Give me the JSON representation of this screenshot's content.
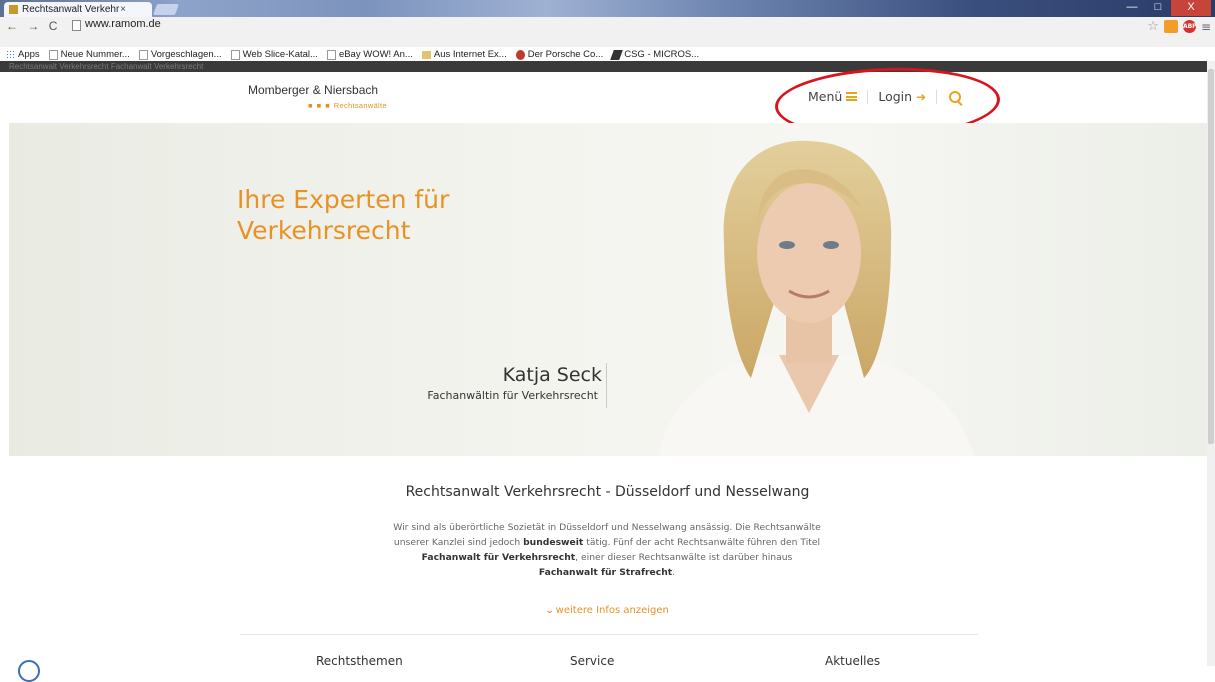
{
  "browser": {
    "tab_title": "Rechtsanwalt Verkehr",
    "tab_close": "×",
    "url": "www.ramom.de",
    "nav": {
      "back": "←",
      "forward": "→",
      "reload": "C"
    },
    "bookmarks": [
      {
        "label": "Apps",
        "icon": "apps"
      },
      {
        "label": "Neue Nummer...",
        "icon": "page"
      },
      {
        "label": "Vorgeschlagen...",
        "icon": "page"
      },
      {
        "label": "Web Slice-Katal...",
        "icon": "page"
      },
      {
        "label": "eBay WOW! An...",
        "icon": "page"
      },
      {
        "label": "Aus Internet Ex...",
        "icon": "folder"
      },
      {
        "label": "Der Porsche Co...",
        "icon": "porsche"
      },
      {
        "label": "CSG - MICROS...",
        "icon": "csg"
      }
    ],
    "status_line": "Rechtsanwalt Verkehrsrecht Fachanwalt Verkehrsrecht",
    "ext_label": "ABP",
    "star": "☆",
    "menu": "≡",
    "window_buttons": {
      "minimize": "—",
      "maximize": "□",
      "close": "X"
    }
  },
  "site": {
    "brand_name": "Momberger & Niersbach",
    "brand_dots": "■ ■ ■",
    "brand_sub": "Rechtsanwälte",
    "nav": {
      "menu": "Menü",
      "login": "Login",
      "login_icon": "➜"
    },
    "hero": {
      "title": "Ihre Experten für Verkehrsrecht",
      "person_name": "Katja Seck",
      "person_role": "Fachanwältin für Verkehrsrecht"
    },
    "section_heading": "Rechtsanwalt Verkehrsrecht - Düsseldorf und Nesselwang",
    "intro": {
      "p1": "Wir sind als überörtliche Sozietät in Düsseldorf und Nesselwang ansässig. Die Rechtsanwälte unserer Kanzlei sind jedoch",
      "b1": "bundesweit",
      "p2": "tätig. Fünf der acht Rechtsanwälte führen den Titel",
      "b2": "Fachanwalt für Verkehrsrecht",
      "p3": ", einer dieser Rechtsanwälte ist darüber hinaus",
      "b3": "Fachanwalt für Strafrecht",
      "p4": "."
    },
    "more_chevron": "⌄",
    "more_link": "weitere Infos anzeigen",
    "footer_columns": [
      "Rechtsthemen",
      "Service",
      "Aktuelles"
    ]
  },
  "colors": {
    "accent": "#e69225",
    "annotation": "#d8141c"
  }
}
